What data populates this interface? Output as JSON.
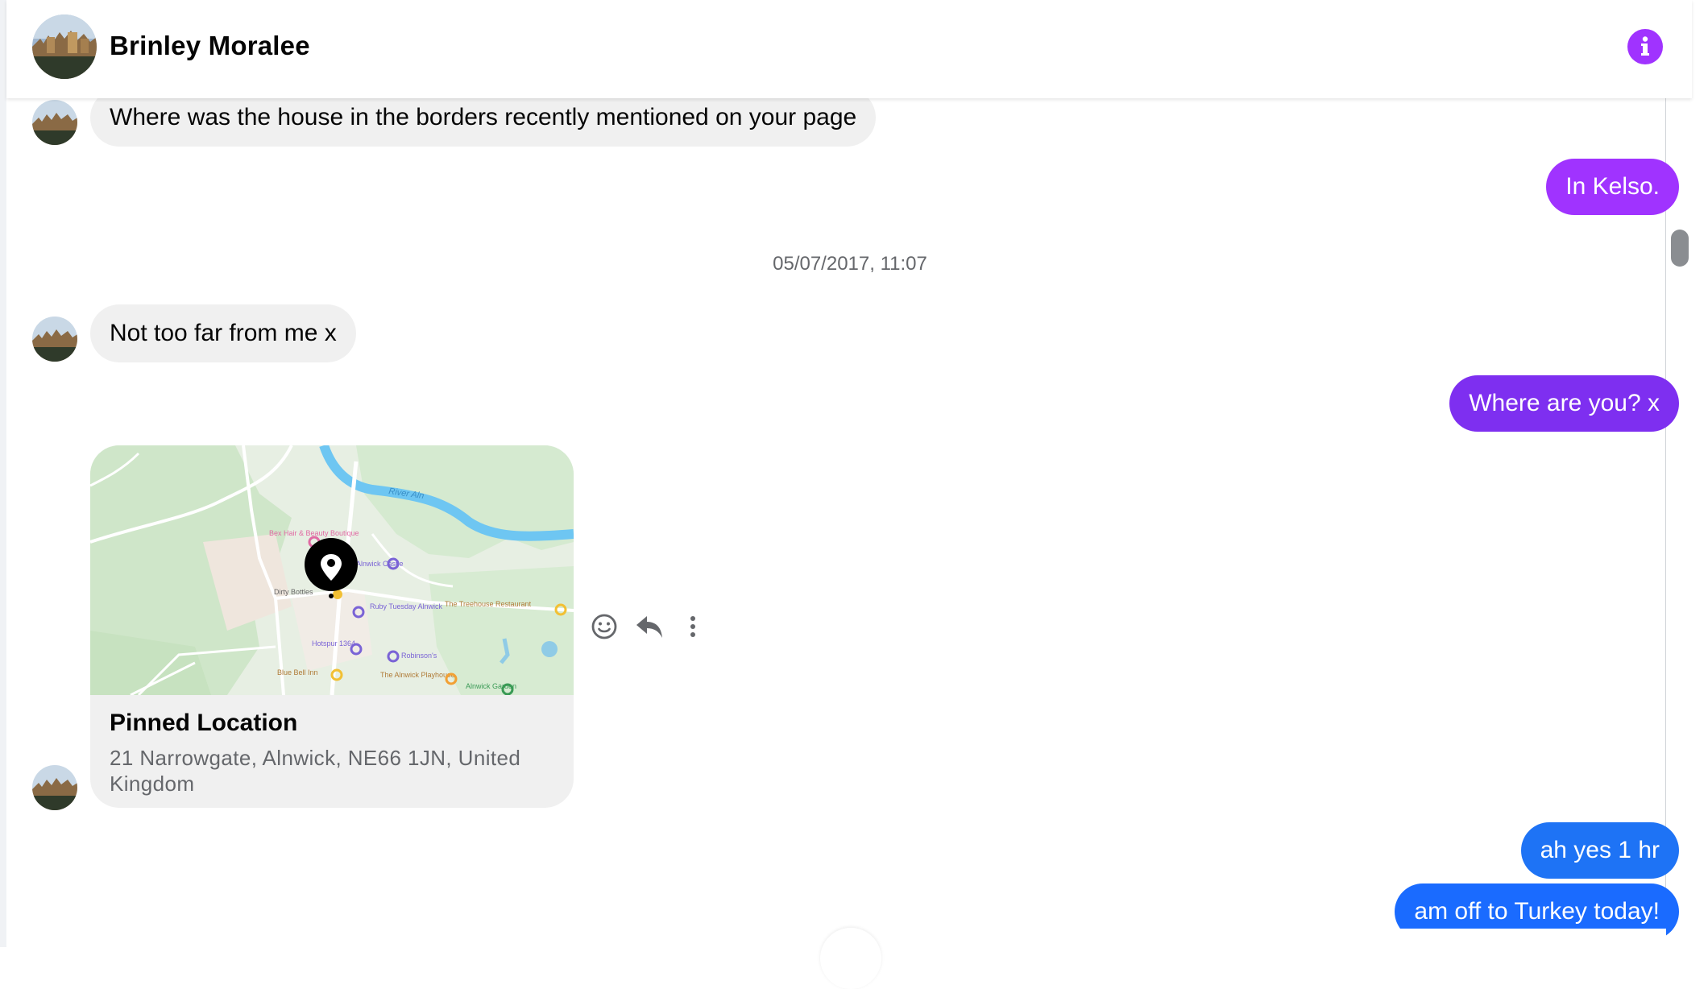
{
  "header": {
    "contact_name": "Brinley Moralee",
    "avatar_icon": "profile-photo-castle",
    "info_icon": "info-icon",
    "accent_color": "#a033ff"
  },
  "messages": [
    {
      "direction": "incoming",
      "text": "Where was the house in the borders recently mentioned on your page"
    },
    {
      "direction": "outgoing",
      "text": "In Kelso.",
      "color": "#a033ff"
    },
    {
      "type": "timestamp",
      "text": "05/07/2017, 11:07"
    },
    {
      "direction": "incoming",
      "text": "Not too far from me x"
    },
    {
      "direction": "outgoing",
      "text": "Where are you? x",
      "color": "#7e2ff0"
    },
    {
      "direction": "incoming",
      "type": "location",
      "title": "Pinned Location",
      "address": "21 Narrowgate, Alnwick, NE66 1JN, United Kingdom",
      "map_labels": [
        "River Aln",
        "Bex Hair & Beauty Boutique",
        "Alnwick Castle",
        "Dirty Bottles",
        "Ruby Tuesday Alnwick",
        "The Treehouse Restaurant",
        "Hotspur 1364",
        "Robinson's",
        "Blue Bell Inn",
        "The Alnwick Playhouse",
        "Alnwick Garden"
      ]
    },
    {
      "direction": "outgoing",
      "text": "ah yes 1 hr",
      "color": "#1e73f5"
    },
    {
      "direction": "outgoing",
      "text": "am off to Turkey today!",
      "color": "#1a6bff"
    }
  ],
  "message_actions": {
    "react_icon": "smiley-icon",
    "reply_icon": "reply-arrow-icon",
    "more_icon": "more-vertical-icon"
  }
}
